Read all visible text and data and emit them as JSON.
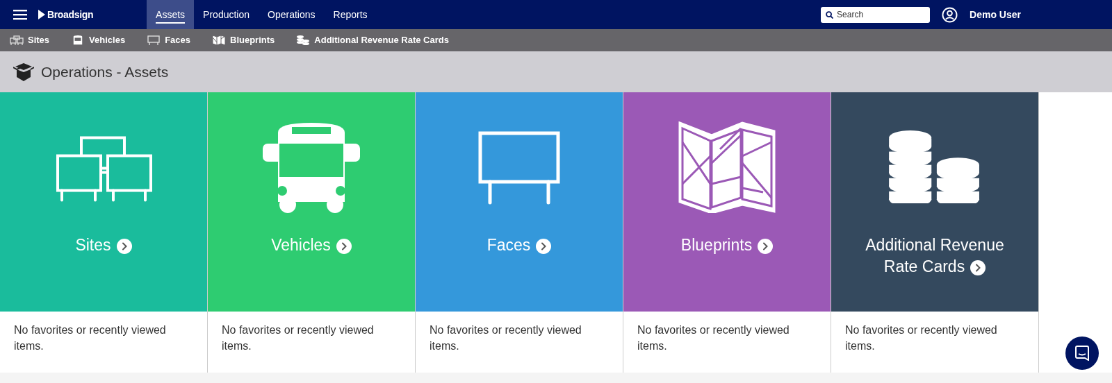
{
  "top_bar": {
    "logo": "Broadsign",
    "nav": [
      {
        "label": "Assets",
        "selected": true
      },
      {
        "label": "Production",
        "selected": false
      },
      {
        "label": "Operations",
        "selected": false
      },
      {
        "label": "Reports",
        "selected": false
      }
    ],
    "search": {
      "placeholder": "Search"
    },
    "user": "Demo User"
  },
  "sub_nav": [
    {
      "label": "Sites",
      "kind": "sites"
    },
    {
      "label": "Vehicles",
      "kind": "bus"
    },
    {
      "label": "Faces",
      "kind": "face"
    },
    {
      "label": "Blueprints",
      "kind": "map"
    },
    {
      "label": "Additional Revenue Rate Cards",
      "kind": "coins"
    }
  ],
  "page_title": "Operations - Assets",
  "cards": [
    {
      "title": "Sites",
      "kind": "sites",
      "color": "#1abc9c",
      "empty_text": "No favorites or recently viewed items."
    },
    {
      "title": "Vehicles",
      "kind": "bus",
      "color": "#2ecc71",
      "empty_text": "No favorites or recently viewed items."
    },
    {
      "title": "Faces",
      "kind": "face",
      "color": "#3498db",
      "empty_text": "No favorites or recently viewed items."
    },
    {
      "title": "Blueprints",
      "kind": "map",
      "color": "#9b59b6",
      "empty_text": "No favorites or recently viewed items."
    },
    {
      "title": "Additional Revenue Rate Cards",
      "kind": "coins",
      "color": "#34495e",
      "empty_text": "No favorites or recently viewed items."
    }
  ]
}
